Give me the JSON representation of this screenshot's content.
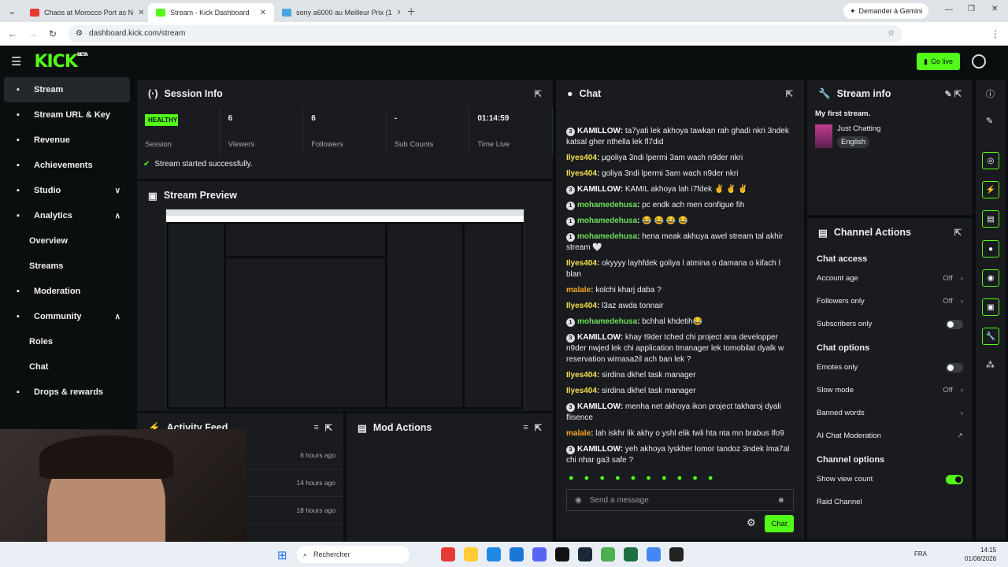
{
  "browser": {
    "tabs": [
      {
        "label": "Chaos at Morocco Port as N",
        "color": "#e53935"
      },
      {
        "label": "Stream - Kick Dashboard",
        "color": "#53fc18",
        "active": true
      },
      {
        "label": "sony a6000 au Meilleur Prix (1",
        "color": "#4aa3df"
      }
    ],
    "url": "dashboard.kick.com/stream",
    "gemini": "Demander à Gemini"
  },
  "header": {
    "logo": "KICK",
    "beta": "BETA",
    "go_live": "Go live"
  },
  "sidebar": [
    {
      "label": "Stream",
      "icon": "dashboard-icon",
      "active": true
    },
    {
      "label": "Stream URL & Key",
      "icon": "link-icon"
    },
    {
      "label": "Revenue",
      "icon": "chart-icon"
    },
    {
      "label": "Achievements",
      "icon": "trophy-icon"
    },
    {
      "label": "Studio",
      "icon": "studio-icon",
      "chev": "∨"
    },
    {
      "label": "Analytics",
      "icon": "analytics-icon",
      "chev": "∧"
    },
    {
      "label": "Overview",
      "sub": true
    },
    {
      "label": "Streams",
      "sub": true
    },
    {
      "label": "Moderation",
      "icon": "wrench-icon"
    },
    {
      "label": "Community",
      "icon": "community-icon",
      "chev": "∧"
    },
    {
      "label": "Roles",
      "sub": true
    },
    {
      "label": "Chat",
      "sub": true
    },
    {
      "label": "Drops & rewards",
      "icon": "drops-icon"
    }
  ],
  "session": {
    "title": "Session Info",
    "status": "HEALTHY",
    "status_label": "Session",
    "stats": [
      {
        "value": "6",
        "label": "Viewers"
      },
      {
        "value": "6",
        "label": "Followers"
      },
      {
        "value": "-",
        "label": "Sub Counts"
      },
      {
        "value": "01:14:59",
        "label": "Time Live"
      }
    ],
    "notice": "Stream started successfully."
  },
  "preview": {
    "title": "Stream Preview"
  },
  "activity": {
    "title": "Activity Feed",
    "times": [
      "6 hours ago",
      "14 hours ago",
      "18 hours ago"
    ]
  },
  "mod": {
    "title": "Mod Actions"
  },
  "chat": {
    "title": "Chat",
    "placeholder": "Send a message",
    "send": "Chat",
    "messages": [
      {
        "badge": "3",
        "user": "KAMILLOW",
        "color": "#ffffff",
        "text": "ta7yati lek akhoya tawkan rah ghadi nkri 3ndek katsal gher nthella lek fl7did"
      },
      {
        "user": "Ilyes404",
        "color": "#f5e04a",
        "text": "µgoliya 3ndi lpermi 3am wach n9der nkri"
      },
      {
        "user": "Ilyes404",
        "color": "#f5e04a",
        "text": "goliya 3ndi lpermi 3am wach n9der nkri"
      },
      {
        "badge": "3",
        "user": "KAMILLOW",
        "color": "#ffffff",
        "text": "KAMIL akhoya lah i7fdek ✌ ✌ ✌"
      },
      {
        "badge": "1",
        "user": "mohamedehusa",
        "color": "#6ee05a",
        "text": "pc endk ach men configue fih"
      },
      {
        "badge": "1",
        "user": "mohamedehusa",
        "color": "#6ee05a",
        "text": "😂 😂 😂 😂"
      },
      {
        "badge": "1",
        "user": "mohamedehusa",
        "color": "#6ee05a",
        "text": "hena meak akhuya awel stream tal akhir stream 🤍"
      },
      {
        "user": "Ilyes404",
        "color": "#f5e04a",
        "text": "okyyyy layhfdek goliya l atmina o damana o kifach l blan"
      },
      {
        "user": "malale",
        "color": "#f5a623",
        "text": "kolchi kharj daba ?"
      },
      {
        "user": "Ilyes404",
        "color": "#f5e04a",
        "text": "l3az awda tonnair"
      },
      {
        "badge": "1",
        "user": "mohamedehusa",
        "color": "#6ee05a",
        "text": "bchhal khdetih😂"
      },
      {
        "badge": "3",
        "user": "KAMILLOW",
        "color": "#ffffff",
        "text": "khay t9der tched chi project ana developper n9der nwjed lek chi application tmanager lek tomobilat dyalk w reservation wimasa2il ach ban lek ?"
      },
      {
        "user": "Ilyes404",
        "color": "#f5e04a",
        "text": "sirdina dkhel task manager"
      },
      {
        "user": "Ilyes404",
        "color": "#f5e04a",
        "text": "sirdina dkhel task manager"
      },
      {
        "badge": "3",
        "user": "KAMILLOW",
        "color": "#ffffff",
        "text": "menha net akhoya ikon project takharoj dyali flisence"
      },
      {
        "user": "malale",
        "color": "#f5a623",
        "text": "lah iskhr lik akhy o yshl elik twli hta nta mn brabus lfo9"
      },
      {
        "badge": "3",
        "user": "KAMILLOW",
        "color": "#ffffff",
        "text": "yeh akhoya lyskher lomor tandoz 3ndek lma7al chi nhar ga3 safe ?"
      }
    ]
  },
  "stream_info": {
    "title": "Stream info",
    "stream_title": "My first stream.",
    "category": "Just Chatting",
    "language": "English"
  },
  "channel": {
    "title": "Channel Actions",
    "chat_access": "Chat access",
    "account_age": {
      "label": "Account age",
      "value": "Off"
    },
    "followers_only": {
      "label": "Followers only",
      "value": "Off"
    },
    "subscribers_only": {
      "label": "Subscribers only"
    },
    "chat_options": "Chat options",
    "emotes_only": {
      "label": "Emotes only"
    },
    "slow_mode": {
      "label": "Slow mode",
      "value": "Off"
    },
    "banned_words": {
      "label": "Banned words"
    },
    "ai_mod": {
      "label": "AI Chat Moderation"
    },
    "channel_options": "Channel options",
    "show_view_count": {
      "label": "Show view count"
    },
    "raid": {
      "label": "Raid Channel"
    }
  },
  "taskbar": {
    "search": "Rechercher",
    "lang": "FRA",
    "time": "14:15",
    "date": "01/08/2026"
  }
}
